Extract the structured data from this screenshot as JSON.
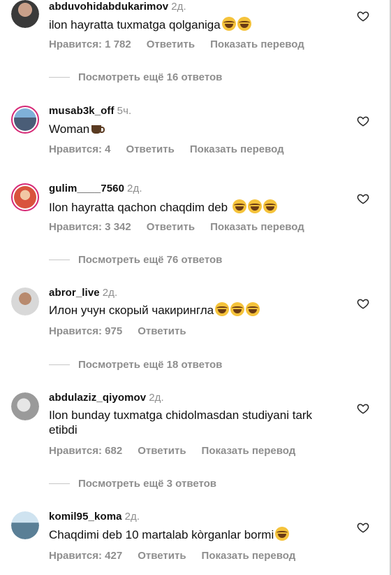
{
  "labels": {
    "like": "Нравится",
    "reply": "Ответить",
    "translate": "Показать перевод"
  },
  "comments": [
    {
      "username": "abduvohidabdukarimov",
      "time": "2д.",
      "text": "ilon hayratta tuxmatga qolganiga",
      "emojis": 2,
      "likes": "Нравится: 1 782",
      "translate": true,
      "replies": "Посмотреть ещё 16 ответов",
      "avatar": "photo"
    },
    {
      "username": "musab3k_off",
      "time": "5ч.",
      "text": "Woman",
      "cup": true,
      "likes": "Нравится: 4",
      "translate": true,
      "replies": "",
      "avatar": "story-ring"
    },
    {
      "username": "gulim____7560",
      "time": "2д.",
      "text": "Ilon hayratta qachon chaqdim deb",
      "emojis": 3,
      "likes": "Нравится: 3 342",
      "translate": true,
      "replies": "Посмотреть ещё 76 ответов",
      "avatar": "story-ring"
    },
    {
      "username": "abror_live",
      "time": "2д.",
      "text": "Илон учун скорый чакирингла",
      "emojis": 3,
      "likes": "Нравится: 975",
      "translate": false,
      "replies": "Посмотреть ещё 18 ответов",
      "avatar": "photo"
    },
    {
      "username": "abdulaziz_qiyomov",
      "time": "2д.",
      "text": "Ilon bunday tuxmatga chidolmasdan studiyani tark etibdi",
      "emojis": 0,
      "likes": "Нравится: 682",
      "translate": true,
      "replies": "Посмотреть ещё 3 ответов",
      "avatar": "photo"
    },
    {
      "username": "komil95_koma",
      "time": "2д.",
      "text": "Chaqdimi deb 10 martalab kòrganlar bormi",
      "emojis": 1,
      "likes": "Нравится: 427",
      "translate": true,
      "replies": "",
      "avatar": "photo"
    }
  ],
  "colors": {
    "text": "#111111",
    "muted": "#8e8e8e",
    "ring": "#d62976",
    "emoji": "#f5c33b"
  }
}
